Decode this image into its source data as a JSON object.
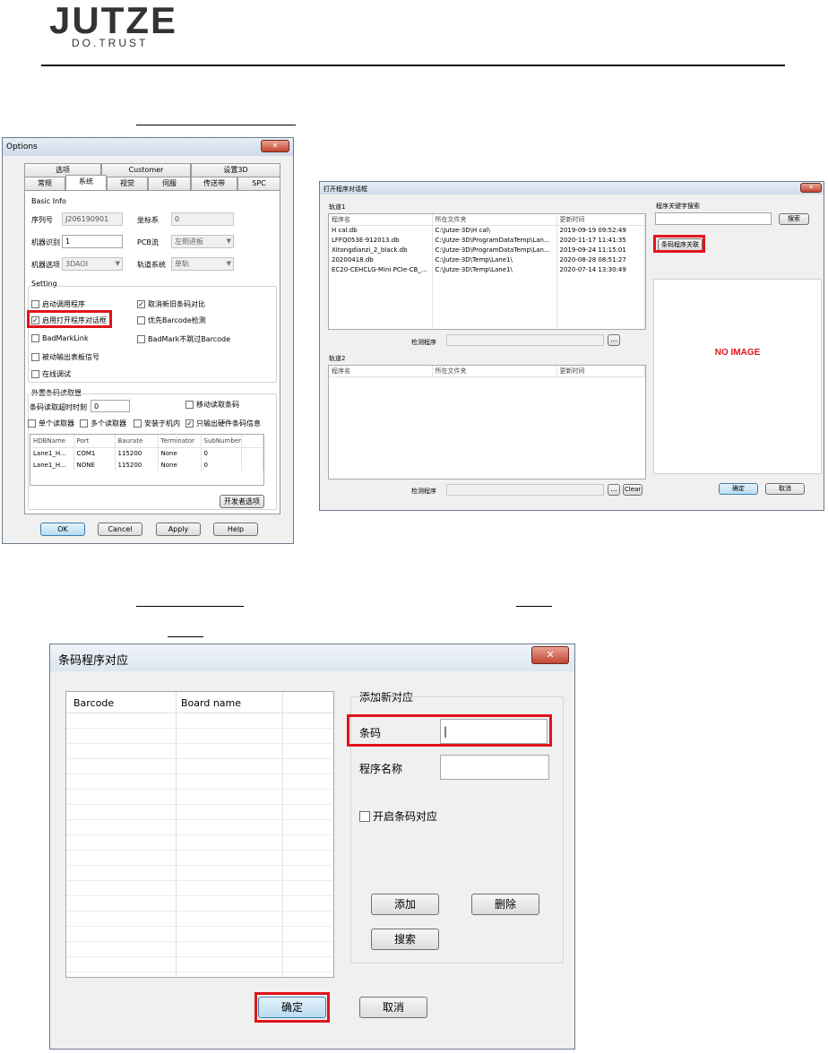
{
  "header": {
    "logo": "JUTZE",
    "tagline": "DO.TRUST"
  },
  "options_dialog": {
    "title": "Options",
    "close_glyph": "✕",
    "tabs_row1": [
      "选项",
      "Customer",
      "设置3D"
    ],
    "tabs_row2": [
      "常规",
      "系统",
      "视觉",
      "伺服",
      "传送带",
      "SPC"
    ],
    "basic_info_label": "Basic Info",
    "serial_label": "序列号",
    "serial_value": "J206190901",
    "coord_label": "坐标系",
    "coord_value": "0",
    "machine_id_label": "机器识别",
    "machine_id_value": "1",
    "pcb_flow_label": "PCB流",
    "pcb_flow_value": "左侧进板",
    "machine_type_label": "机器选项",
    "machine_type_value": "3DAOI",
    "track_label": "轨道系统",
    "track_value": "单轨",
    "setting_label": "Setting",
    "checks": [
      {
        "label": "启动调用程序",
        "checked": false
      },
      {
        "label": "取消新旧条码对比",
        "checked": true
      },
      {
        "label": "启用打开程序对话框",
        "checked": true
      },
      {
        "label": "优先Barcode检测",
        "checked": false
      },
      {
        "label": "BadMarkLink",
        "checked": false
      },
      {
        "label": "BadMark不跳过Barcode",
        "checked": false
      },
      {
        "label": "被动输出表板信号",
        "checked": false
      },
      {
        "label": "在线调试",
        "checked": false
      }
    ],
    "reader_label": "外置条码读取器",
    "timeout_label": "条码读取超时时刻",
    "timeout_value": "0",
    "move_read_label": "移动读取条码",
    "reader_checks": [
      {
        "label": "单个读取器",
        "checked": false
      },
      {
        "label": "多个读取器",
        "checked": false
      },
      {
        "label": "安装于机内",
        "checked": false
      },
      {
        "label": "只输出硬件条码信息",
        "checked": true
      }
    ],
    "table_headers": [
      "HDBName",
      "Port",
      "Baurate",
      "Terminator",
      "SubNumber"
    ],
    "table_rows": [
      [
        "Lane1_H...",
        "COM1",
        "115200",
        "None",
        "0"
      ],
      [
        "Lane1_H...",
        "NONE",
        "115200",
        "None",
        "0"
      ]
    ],
    "dev_button": "开发者选项",
    "ok": "OK",
    "cancel": "Cancel",
    "apply": "Apply",
    "help": "Help"
  },
  "open_program_dialog": {
    "title": "打开程序对话框",
    "close_glyph": "✕",
    "track1_label": "轨道1",
    "track2_label": "轨道2",
    "col_headers": [
      "程序名",
      "所在文件夹",
      "更新时间"
    ],
    "rows": [
      [
        "H cal.db",
        "C:\\Jutze-3D\\H cal\\",
        "2019-09-19 09:52:49"
      ],
      [
        "LFFQ053E-912013.db",
        "C:\\Jutze-3D\\ProgramDataTemp\\Lan...",
        "2020-11-17 11:41:35"
      ],
      [
        "Xitongdianzi_2_black.db",
        "C:\\Jutze-3D\\ProgramDataTemp\\Lan...",
        "2019-09-24 11:15:01"
      ],
      [
        "20200418.db",
        "C:\\Jutze-3D\\Temp\\Lane1\\",
        "2020-08-28 08:51:27"
      ],
      [
        "EC20-CEHCLG-Mini PCIe-CB_...",
        "C:\\Jutze-3D\\Temp\\Lane1\\",
        "2020-07-14 13:30:49"
      ]
    ],
    "detect_label": "检测程序",
    "browse": "...",
    "clear": "Clear",
    "keyword_label": "程序关键字搜索",
    "search_button": "搜索",
    "barcode_link_button": "条码程序关联",
    "no_image": "NO IMAGE",
    "ok": "确定",
    "cancel": "取消"
  },
  "barcode_dialog": {
    "title": "条码程序对应",
    "close_glyph": "✕",
    "col_barcode": "Barcode",
    "col_board": "Board name",
    "group_label": "添加新对应",
    "barcode_label": "条码",
    "barcode_value": "|",
    "program_label": "程序名称",
    "program_value": "",
    "enable_label": "开启条码对应",
    "enable_checked": false,
    "add": "添加",
    "delete": "删除",
    "search": "搜索",
    "ok": "确定",
    "cancel": "取消"
  }
}
